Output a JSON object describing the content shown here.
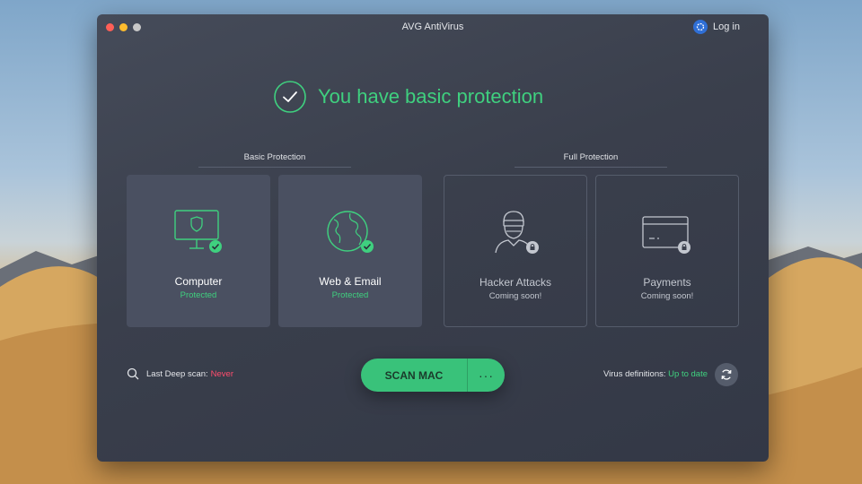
{
  "window": {
    "title": "AVG AntiVirus",
    "login_label": "Log in"
  },
  "status": {
    "title": "You have basic protection",
    "color": "#3fd07f"
  },
  "sections": {
    "basic": "Basic Protection",
    "full": "Full Protection"
  },
  "cards": [
    {
      "title": "Computer",
      "status": "Protected",
      "icon": "monitor-shield-icon",
      "state": "protected"
    },
    {
      "title": "Web & Email",
      "status": "Protected",
      "icon": "globe-icon",
      "state": "protected"
    },
    {
      "title": "Hacker Attacks",
      "status": "Coming soon!",
      "icon": "hacker-icon",
      "state": "locked"
    },
    {
      "title": "Payments",
      "status": "Coming soon!",
      "icon": "credit-card-icon",
      "state": "locked"
    }
  ],
  "scan": {
    "last_label": "Last Deep scan:",
    "last_value": "Never",
    "button_label": "SCAN MAC",
    "more_label": "···"
  },
  "definitions": {
    "label": "Virus definitions:",
    "value": "Up to date"
  },
  "colors": {
    "accent": "#3fd07f",
    "button": "#39c27a",
    "alert": "#ff4d6d",
    "window_bg": "#3a3f4c"
  }
}
